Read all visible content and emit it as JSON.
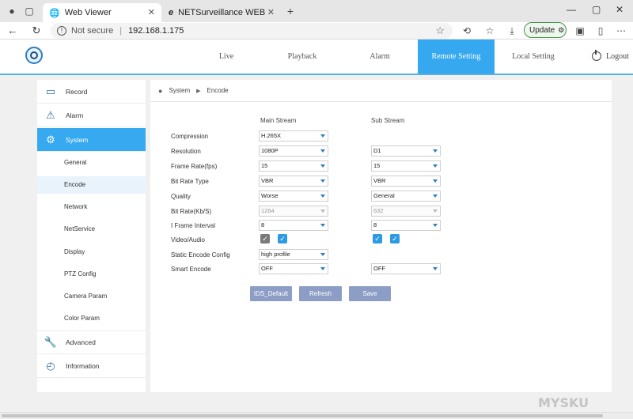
{
  "browser": {
    "tabs": [
      {
        "title": "Web Viewer",
        "active": true
      },
      {
        "title": "NETSurveillance WEB",
        "active": false
      }
    ],
    "address": {
      "security": "Not secure",
      "url": "192.168.1.175"
    },
    "update_label": "Update"
  },
  "header": {
    "menu": [
      "Live",
      "Playback",
      "Alarm",
      "Remote Setting",
      "Local Setting"
    ],
    "active_menu": "Remote Setting",
    "logout_label": "Logout"
  },
  "sidebar": {
    "items": [
      {
        "label": "Record",
        "icon": "record-icon"
      },
      {
        "label": "Alarm",
        "icon": "alarm-icon"
      },
      {
        "label": "System",
        "icon": "gear-icon",
        "active": true
      },
      {
        "label": "Advanced",
        "icon": "wrench-icon"
      },
      {
        "label": "Information",
        "icon": "chart-icon"
      }
    ],
    "subitems": [
      "General",
      "Encode",
      "Network",
      "NetService",
      "Display",
      "PTZ Config",
      "Camera Param",
      "Color Param"
    ],
    "active_sub": "Encode"
  },
  "breadcrumb": [
    "System",
    "Encode"
  ],
  "encode": {
    "main_stream_label": "Main Stream",
    "sub_stream_label": "Sub Stream",
    "labels": {
      "compression": "Compression",
      "resolution": "Resolution",
      "frame_rate": "Frame Rate(fps)",
      "bit_rate_type": "Bit Rate Type",
      "quality": "Quality",
      "bit_rate": "Bit Rate(Kb/S)",
      "i_frame": "I Frame Interval",
      "video_audio": "Video/Audio",
      "static_encode": "Static Encode Config",
      "smart_encode": "Smart Encode"
    },
    "main": {
      "compression": "H.265X",
      "resolution": "1080P",
      "frame_rate": "15",
      "bit_rate_type": "VBR",
      "quality": "Worse",
      "bit_rate": "1264",
      "i_frame": "8",
      "video_checked": true,
      "audio_checked": true,
      "static_encode": "high profile",
      "smart_encode": "OFF"
    },
    "sub": {
      "resolution": "D1",
      "frame_rate": "15",
      "bit_rate_type": "VBR",
      "quality": "General",
      "bit_rate": "632",
      "i_frame": "8",
      "video_checked": true,
      "audio_checked": true,
      "smart_encode": "OFF"
    }
  },
  "buttons": {
    "default": "IDS_Default",
    "refresh": "Refresh",
    "save": "Save"
  },
  "watermark": "MYSKU"
}
